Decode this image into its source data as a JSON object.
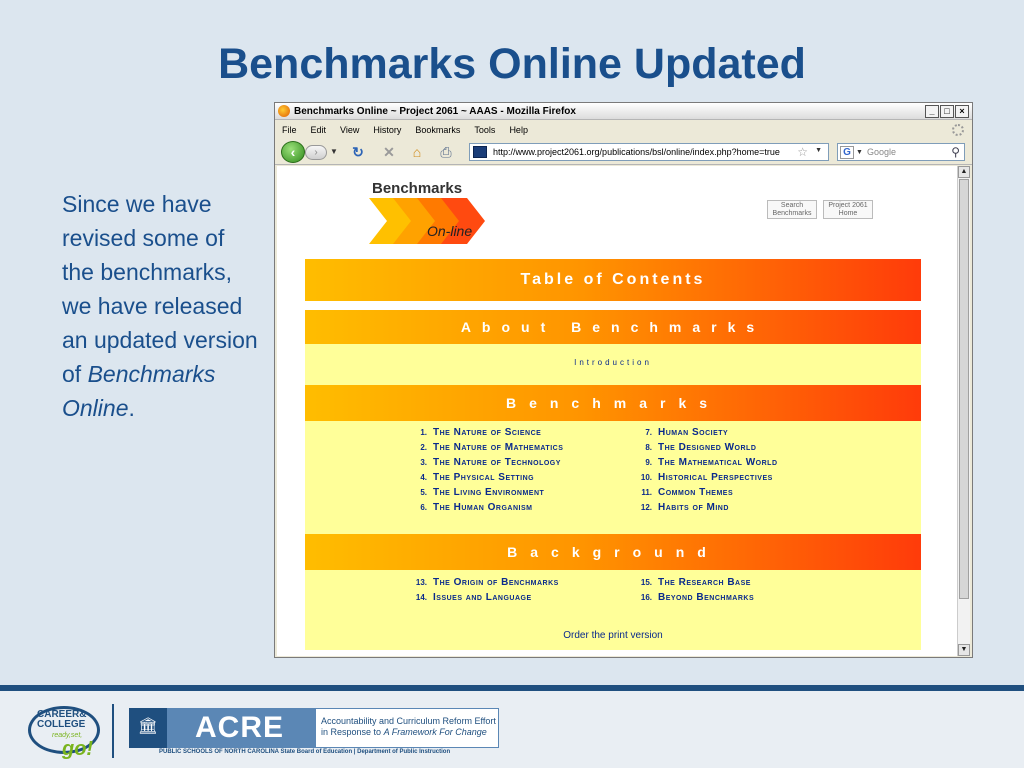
{
  "slide": {
    "title": "Benchmarks Online Updated",
    "body_text": "Since we have revised some of the benchmarks, we have released an updated version of",
    "body_emphasis": "Benchmarks Online",
    "body_end": "."
  },
  "browser": {
    "window_title": "Benchmarks Online ~ Project 2061 ~ AAAS - Mozilla Firefox",
    "window_buttons": [
      "_",
      "□",
      "×"
    ],
    "menu": [
      "File",
      "Edit",
      "View",
      "History",
      "Bookmarks",
      "Tools",
      "Help"
    ],
    "url": "http://www.project2061.org/publications/bsl/online/index.php?home=true",
    "search_placeholder": "Google",
    "search_engine_glyph": "G"
  },
  "page": {
    "logo_title": "Benchmarks",
    "logo_subtitle": "On-line",
    "top_buttons": [
      "Search Benchmarks",
      "Project 2061 Home"
    ],
    "toc_heading": "Table of Contents",
    "about_heading": "About Benchmarks",
    "intro_link": "Introduction",
    "benchmarks_heading": "Benchmarks",
    "benchmarks_left": [
      {
        "num": "1.",
        "label": "The Nature of Science"
      },
      {
        "num": "2.",
        "label": "The Nature of Mathematics"
      },
      {
        "num": "3.",
        "label": "The Nature of Technology"
      },
      {
        "num": "4.",
        "label": "The Physical Setting"
      },
      {
        "num": "5.",
        "label": "The Living Environment"
      },
      {
        "num": "6.",
        "label": "The Human Organism"
      }
    ],
    "benchmarks_right": [
      {
        "num": "7.",
        "label": "Human Society"
      },
      {
        "num": "8.",
        "label": "The Designed World"
      },
      {
        "num": "9.",
        "label": "The Mathematical World"
      },
      {
        "num": "10.",
        "label": "Historical Perspectives"
      },
      {
        "num": "11.",
        "label": "Common Themes"
      },
      {
        "num": "12.",
        "label": "Habits of Mind"
      }
    ],
    "background_heading": "Background",
    "background_left": [
      {
        "num": "13.",
        "label": "The Origin of Benchmarks"
      },
      {
        "num": "14.",
        "label": "Issues and Language"
      }
    ],
    "background_right": [
      {
        "num": "15.",
        "label": "The Research Base"
      },
      {
        "num": "16.",
        "label": "Beyond Benchmarks"
      }
    ],
    "print_link": "Order the print version"
  },
  "footer": {
    "ccg_line1": "CAREER&",
    "ccg_line2": "COLLEGE",
    "ccg_ready": "ready,set,",
    "ccg_go": "go!",
    "acre_name": "ACRE",
    "acre_desc_line1": "Accountability and Curriculum Reform Effort",
    "acre_desc_line2": "in Response to",
    "acre_desc_emph": "A Framework For Change",
    "acre_sub": "PUBLIC SCHOOLS OF NORTH CAROLINA  State Board of Education | Department of Public Instruction"
  },
  "colors": {
    "background": "#dce6ef",
    "title": "#1a4f8c",
    "band_start": "#ffbd00",
    "band_end": "#ff3b0a",
    "panel": "#ffff99",
    "link": "#0a2a8c",
    "footer_rule": "#1f4f7f"
  }
}
